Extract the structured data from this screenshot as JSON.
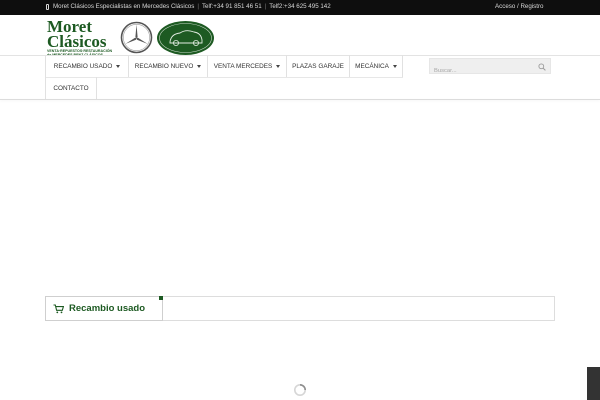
{
  "topbar": {
    "tagline": "Moret Clásicos Especialistas en Mercedes Clásicos",
    "phone1": "Telf:+34 91 851 46 51",
    "phone2": "Telf2:+34 625 495 142",
    "login": "Acceso / Registro"
  },
  "logo": {
    "line1": "Moret",
    "line2": "Clásicos",
    "sub1": "VENTA·REPUESTOS·RESTAURACIÓN",
    "sub2": "de MERCEDES BENZ CLÁSICOS",
    "badge_text": "Moret Clásicos"
  },
  "nav": {
    "items": [
      {
        "label": "Recambio usado",
        "dropdown": true
      },
      {
        "label": "Recambio nuevo",
        "dropdown": true
      },
      {
        "label": "Venta Mercedes",
        "dropdown": true
      },
      {
        "label": "Plazas garaje",
        "dropdown": false
      },
      {
        "label": "Mecánica",
        "dropdown": true
      }
    ],
    "row2": [
      {
        "label": "Contacto"
      }
    ]
  },
  "search": {
    "placeholder": "Buscar..."
  },
  "section": {
    "title": "Recambio usado"
  },
  "colors": {
    "brand_green": "#1d5a22",
    "topbar_bg": "#0e0e0e"
  }
}
